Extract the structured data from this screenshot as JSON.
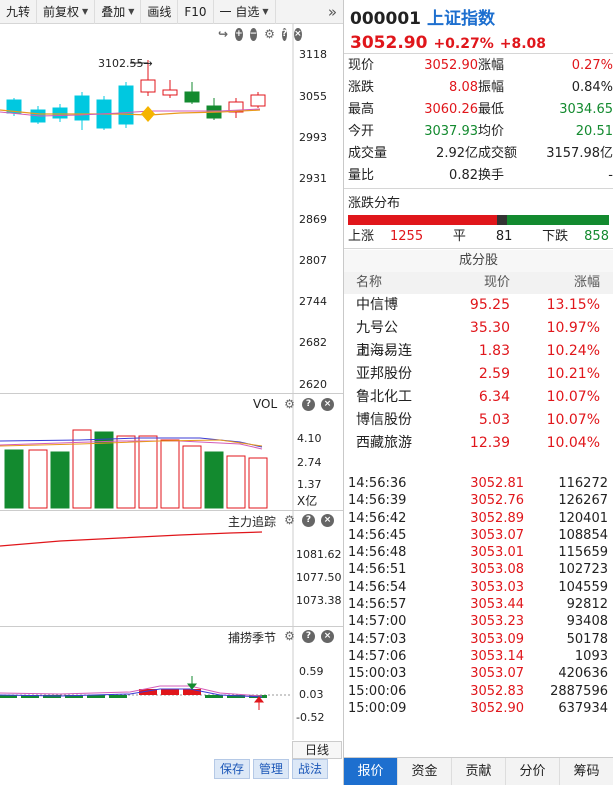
{
  "toolbar": {
    "items": [
      "九转",
      "前复权",
      "叠加",
      "画线",
      "F10",
      "一 自选"
    ],
    "dropdown": [
      false,
      true,
      true,
      false,
      false,
      true
    ]
  },
  "price_axis": [
    "3118",
    "3055",
    "2993",
    "2931",
    "2869",
    "2807",
    "2744",
    "2682",
    "2620"
  ],
  "high_marker": "3102.55→",
  "vol_panel": {
    "title": "VOL",
    "axis": [
      "4.10",
      "2.74",
      "1.37",
      "X亿"
    ]
  },
  "trace_panel": {
    "title": "主力追踪",
    "axis": [
      "1081.62",
      "1077.50",
      "1073.38"
    ]
  },
  "season_panel": {
    "title": "捕捞季节",
    "axis": [
      "0.59",
      "0.03",
      "-0.52"
    ]
  },
  "buttons": {
    "save": "保存",
    "manage": "管理",
    "tactic": "战法",
    "dline": "日线"
  },
  "header": {
    "code": "000001",
    "name": "上证指数",
    "price": "3052.90",
    "pct": "+0.27%",
    "chg": "+8.08"
  },
  "stats": [
    [
      {
        "k": "现价",
        "v": "3052.90",
        "c": "red"
      },
      {
        "k": "涨幅",
        "v": "0.27%",
        "c": "red"
      }
    ],
    [
      {
        "k": "涨跌",
        "v": "8.08",
        "c": "red"
      },
      {
        "k": "振幅",
        "v": "0.84%",
        "c": "black"
      }
    ],
    [
      {
        "k": "最高",
        "v": "3060.26",
        "c": "red"
      },
      {
        "k": "最低",
        "v": "3034.65",
        "c": "green"
      }
    ],
    [
      {
        "k": "今开",
        "v": "3037.93",
        "c": "green"
      },
      {
        "k": "均价",
        "v": "20.51",
        "c": "green"
      }
    ],
    [
      {
        "k": "成交量",
        "v": "2.92亿",
        "c": "black"
      },
      {
        "k": "成交额",
        "v": "3157.98亿",
        "c": "black"
      }
    ],
    [
      {
        "k": "量比",
        "v": "0.82",
        "c": "black"
      },
      {
        "k": "换手",
        "v": "-",
        "c": "black"
      }
    ]
  ],
  "distribution": {
    "title": "涨跌分布",
    "up_label": "上涨",
    "up": "1255",
    "flat_label": "平",
    "flat": "81",
    "down_label": "下跌",
    "down": "858"
  },
  "components": {
    "title": "成分股",
    "headers": [
      "名称",
      "现价",
      "涨幅"
    ],
    "rows": [
      [
        "中信博",
        "95.25",
        "13.15%"
      ],
      [
        "九号公司-...",
        "35.30",
        "10.97%"
      ],
      [
        "上海易连",
        "1.83",
        "10.24%"
      ],
      [
        "亚邦股份",
        "2.59",
        "10.21%"
      ],
      [
        "鲁北化工",
        "6.34",
        "10.07%"
      ],
      [
        "博信股份",
        "5.03",
        "10.07%"
      ],
      [
        "西藏旅游",
        "12.39",
        "10.04%"
      ]
    ]
  },
  "ticks": [
    [
      "14:56:36",
      "3052.81",
      "116272"
    ],
    [
      "14:56:39",
      "3052.76",
      "126267"
    ],
    [
      "14:56:42",
      "3052.89",
      "120401"
    ],
    [
      "14:56:45",
      "3053.07",
      "108854"
    ],
    [
      "14:56:48",
      "3053.01",
      "115659"
    ],
    [
      "14:56:51",
      "3053.08",
      "102723"
    ],
    [
      "14:56:54",
      "3053.03",
      "104559"
    ],
    [
      "14:56:57",
      "3053.44",
      "92812"
    ],
    [
      "14:57:00",
      "3053.23",
      "93408"
    ],
    [
      "14:57:03",
      "3053.09",
      "50178"
    ],
    [
      "14:57:06",
      "3053.14",
      "1093"
    ],
    [
      "15:00:03",
      "3053.07",
      "420636"
    ],
    [
      "15:00:06",
      "3052.83",
      "2887596"
    ],
    [
      "15:00:09",
      "3052.90",
      "637934"
    ]
  ],
  "tabs": [
    "报价",
    "资金",
    "贡献",
    "分价",
    "筹码"
  ],
  "colors": {
    "up": "#e0161b",
    "down": "#138a2f",
    "cyan": "#00c8e0",
    "accent": "#1d6fcf"
  }
}
